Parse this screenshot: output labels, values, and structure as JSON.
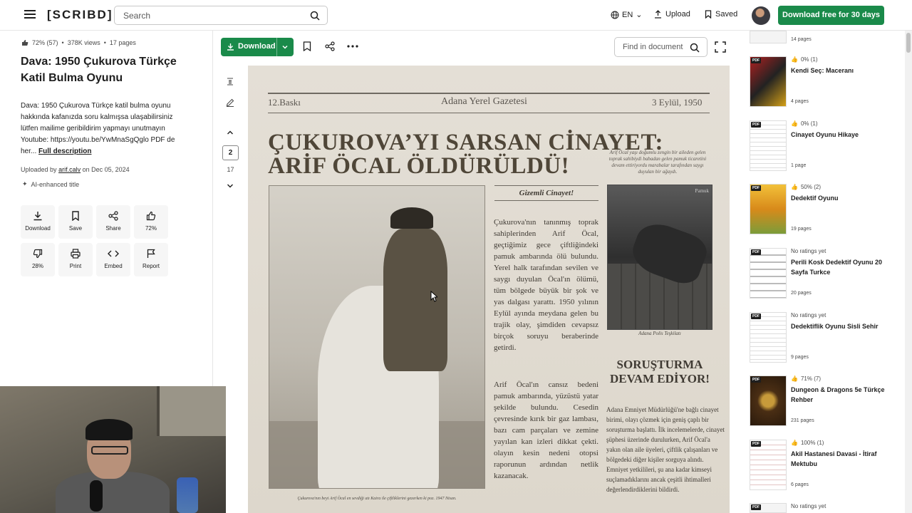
{
  "header": {
    "logo": "[SCRIBD]",
    "search_placeholder": "Search",
    "language": "EN",
    "upload": "Upload",
    "saved": "Saved",
    "cta": "Download free for 30 days"
  },
  "document": {
    "rating": "72% (57)",
    "views": "378K views",
    "pages": "17 pages",
    "title": "Dava: 1950 Çukurova Türkçe Katil Bulma Oyunu",
    "description": "Dava: 1950 Çukurova Türkçe katil bulma oyunu hakkında kafanızda soru kalmışsa ulaşabilirsiniz lütfen mailime geribildirim yapmayı unutmayın Youtube: https://youtu.be/YwMnaSgQglo PDF de her...",
    "full_description": "Full description",
    "uploaded_prefix": "Uploaded by",
    "uploader": "arif.calv",
    "uploaded_date": "on Dec 05, 2024",
    "ai_title": "AI-enhanced title"
  },
  "actions": [
    {
      "label": "Download",
      "icon": "download-icon"
    },
    {
      "label": "Save",
      "icon": "bookmark-icon"
    },
    {
      "label": "Share",
      "icon": "share-icon"
    },
    {
      "label": "72%",
      "icon": "thumbs-up-icon"
    },
    {
      "label": "28%",
      "icon": "thumbs-down-icon"
    },
    {
      "label": "Print",
      "icon": "print-icon"
    },
    {
      "label": "Embed",
      "icon": "embed-icon"
    },
    {
      "label": "Report",
      "icon": "flag-icon"
    }
  ],
  "toolbar": {
    "download": "Download",
    "find_placeholder": "Find in document",
    "current_page": "2",
    "total_pages": "17"
  },
  "newspaper": {
    "edition": "12.Baskı",
    "paper_name": "Adana Yerel Gazetesi",
    "date": "3 Eylül, 1950",
    "headline": "ÇUKUROVA’YI SARSAN CİNAYET: ARİF ÖCAL ÖLDÜRÜLDÜ!",
    "side_caption": "Arif Öcal yaşı doğumlu zengin bir aileden gelen toprak sahibiydi babadan gelen pamuk ticaretini devam ettiriyordu marabalar tarafından saygı duyulan bir ağaydı.",
    "main_photo_caption": "Çukurova'nın beyi Arif Öcal en sevdiği atı Kaira ile çiftliklerini gezerken ki poz. 1947 Nisan.",
    "col_head": "Gizemli Cinayet!",
    "para1": "Çukurova'nın tanınmış toprak sahiplerinden Arif Öcal, geçtiğimiz gece çiftliğindeki pamuk ambarında ölü bulundu. Yerel halk tarafından sevilen ve saygı duyulan Öcal'ın ölümü, tüm bölgede büyük bir şok ve yas dalgası yarattı. 1950 yılının Eylül ayında meydana gelen bu trajik olay, şimdiden cevapsız birçok soruyu beraberinde getirdi.",
    "para2": "Arif Öcal'ın cansız bedeni pamuk ambarında, yüzüstü yatar şekilde bulundu. Cesedin çevresinde kırık bir gaz lambası, bazı cam parçaları ve zemine yayılan kan izleri dikkat çekti. olayın kesin nedeni otopsi raporunun ardından netlik kazanacak.",
    "side_photo_label": "Pamuk",
    "side_photo_caption": "Adana Polis Teşkilatı",
    "subhead": "SORUŞTURMA DEVAM EDİYOR!",
    "side_text": "Adana Emniyet Müdürlüğü'ne bağlı cinayet birimi, olayı çözmek için geniş çaplı bir soruşturma başlattı. İlk incelemelerde, cinayet şüphesi üzerinde durulurken, Arif Öcal'a yakın olan aile üyeleri, çiftlik çalışanları ve bölgedeki diğer kişiler sorguya alındı. Emniyet yetkilileri, şu ana kadar kimseyi suçlamadıklarını ancak çeşitli ihtimalleri değerlendirdiklerini bildirdi."
  },
  "recommendations": [
    {
      "rating": "",
      "title": "",
      "pages": "14 pages",
      "badge": ""
    },
    {
      "rating": "0% (1)",
      "title": "Kendi Seç: Maceranı",
      "pages": "4 pages",
      "badge": "PDF"
    },
    {
      "rating": "0% (1)",
      "title": "Cinayet Oyunu Hikaye",
      "pages": "1 page",
      "badge": "PDF"
    },
    {
      "rating": "50% (2)",
      "title": "Dedektif Oyunu",
      "pages": "19 pages",
      "badge": "PDF"
    },
    {
      "rating": "No ratings yet",
      "title": "Perili Kosk Dedektif Oyunu 20 Sayfa Turkce",
      "pages": "20 pages",
      "badge": "PDF"
    },
    {
      "rating": "No ratings yet",
      "title": "Dedektiflik Oyunu Sisli Sehir",
      "pages": "9 pages",
      "badge": "PDF"
    },
    {
      "rating": "71% (7)",
      "title": "Dungeon & Dragons 5e Türkçe Rehber",
      "pages": "231 pages",
      "badge": "PDF"
    },
    {
      "rating": "100% (1)",
      "title": "Akil Hastanesi Davasi - İtiraf Mektubu",
      "pages": "6 pages",
      "badge": "PDF"
    },
    {
      "rating": "No ratings yet",
      "title": "",
      "pages": "",
      "badge": "PDF"
    }
  ]
}
